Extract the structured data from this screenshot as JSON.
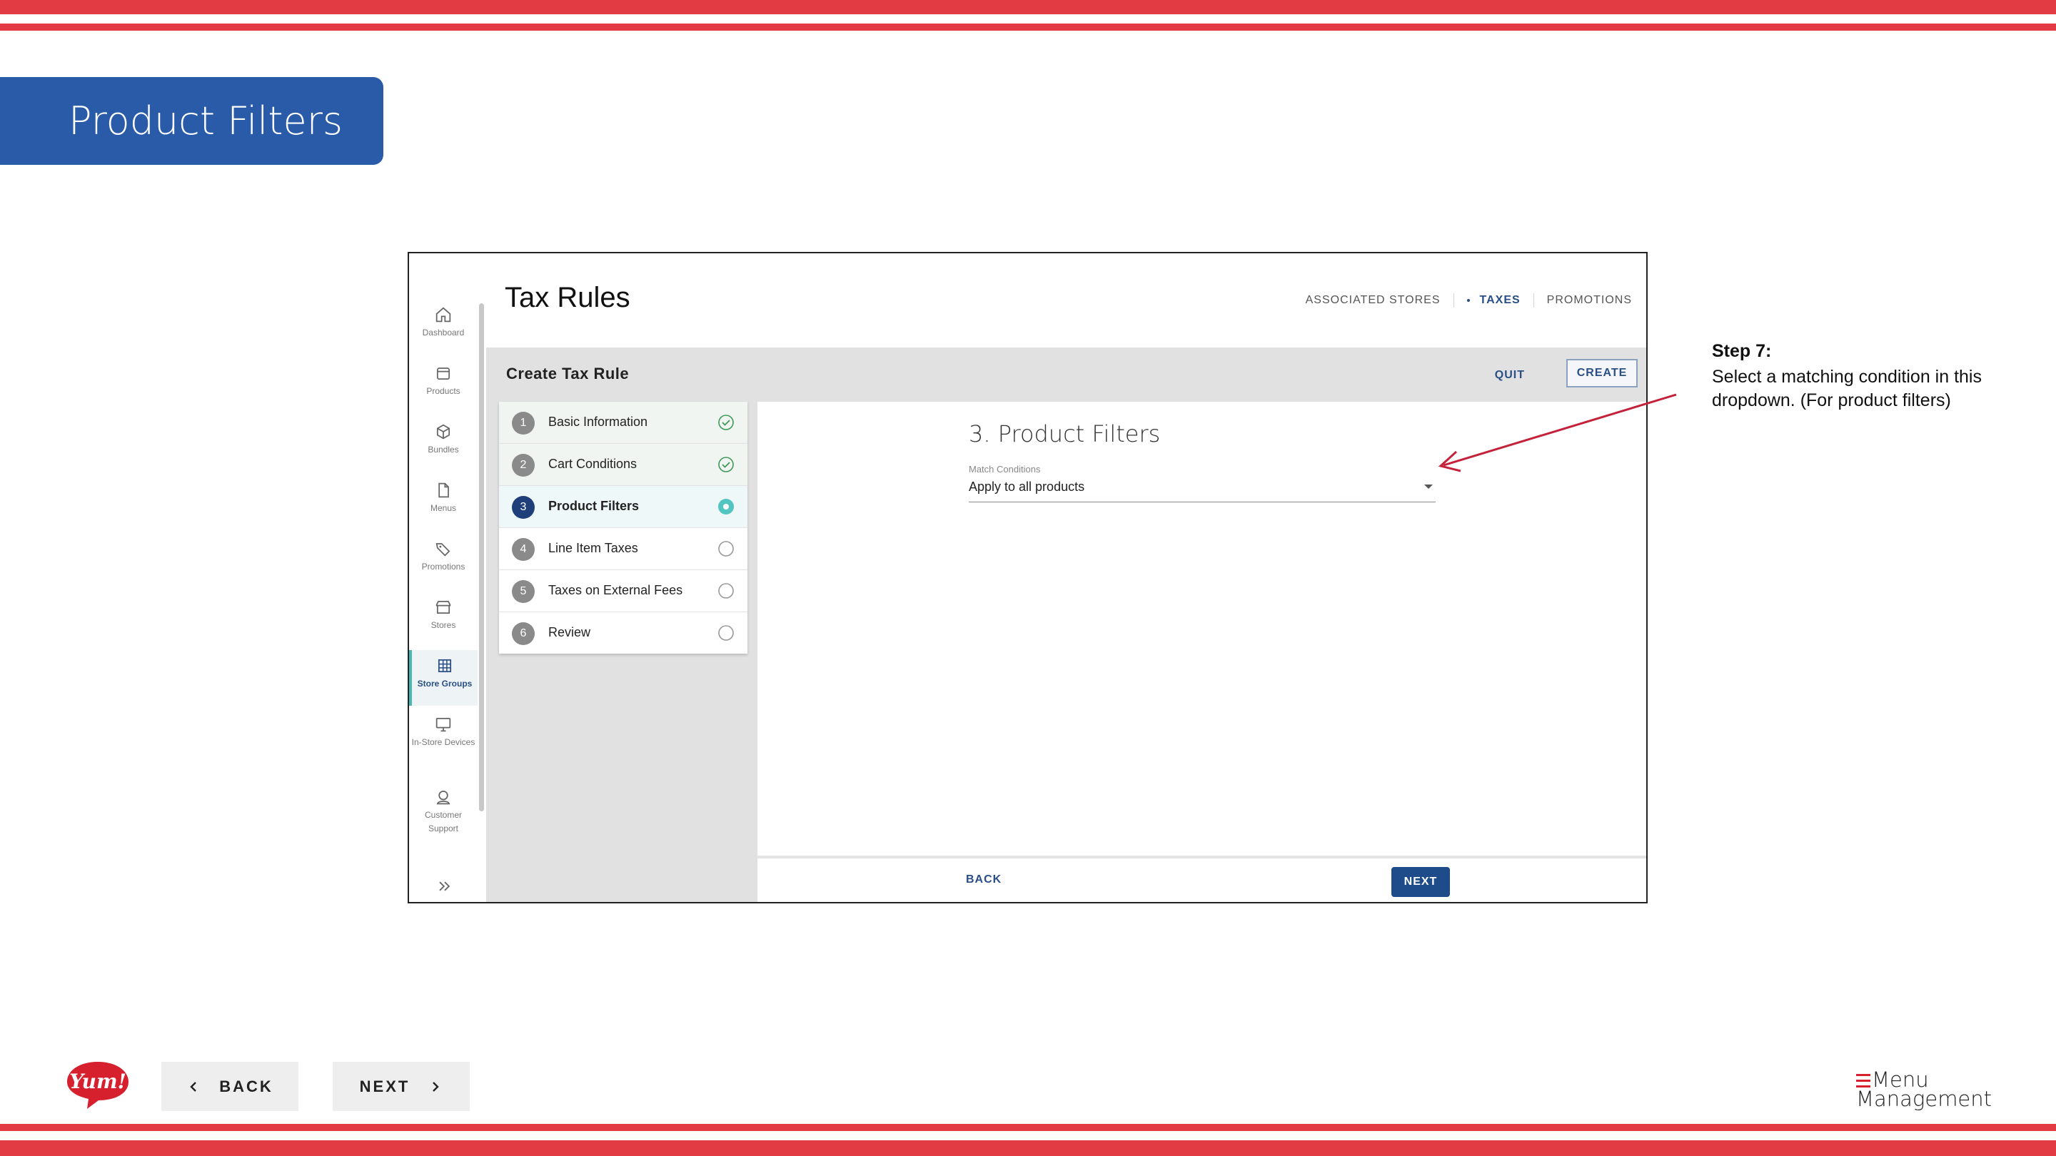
{
  "slide": {
    "title": "Product Filters",
    "callout_title": "Step 7:",
    "callout_text": "Select a matching condition in this dropdown. (For product filters)",
    "back_label": "BACK",
    "next_label": "NEXT",
    "brand_line1": "Menu",
    "brand_line2": "Management",
    "logo_text": "Yum!"
  },
  "sidebar": {
    "items": [
      {
        "label": "Dashboard",
        "icon": "home-icon"
      },
      {
        "label": "Products",
        "icon": "box-icon"
      },
      {
        "label": "Bundles",
        "icon": "cube-icon"
      },
      {
        "label": "Menus",
        "icon": "document-icon"
      },
      {
        "label": "Promotions",
        "icon": "tag-icon"
      },
      {
        "label": "Stores",
        "icon": "storefront-icon"
      },
      {
        "label": "Store Groups",
        "icon": "grid-icon",
        "active": true
      },
      {
        "label": "In-Store Devices",
        "icon": "monitor-icon"
      },
      {
        "label": "Customer Support",
        "icon": "support-icon"
      }
    ]
  },
  "header": {
    "title": "Tax Rules",
    "tabs": [
      "ASSOCIATED STORES",
      "TAXES",
      "PROMOTIONS"
    ],
    "active_tab": "TAXES"
  },
  "band": {
    "title": "Create Tax Rule",
    "quit_label": "QUIT",
    "create_label": "CREATE"
  },
  "steps": [
    {
      "num": "1",
      "label": "Basic Information",
      "status": "done"
    },
    {
      "num": "2",
      "label": "Cart Conditions",
      "status": "done"
    },
    {
      "num": "3",
      "label": "Product Filters",
      "status": "current"
    },
    {
      "num": "4",
      "label": "Line Item Taxes",
      "status": "pending"
    },
    {
      "num": "5",
      "label": "Taxes on External Fees",
      "status": "pending"
    },
    {
      "num": "6",
      "label": "Review",
      "status": "pending"
    }
  ],
  "form": {
    "section_title": "3. Product Filters",
    "match_label": "Match Conditions",
    "match_value": "Apply to all products",
    "back_label": "BACK",
    "next_label": "NEXT"
  },
  "colors": {
    "stripe": "#e23b44",
    "banner": "#2a5ba8",
    "primary": "#1e4b8a",
    "accent": "#4bb7b0",
    "arrow": "#c4213a"
  }
}
